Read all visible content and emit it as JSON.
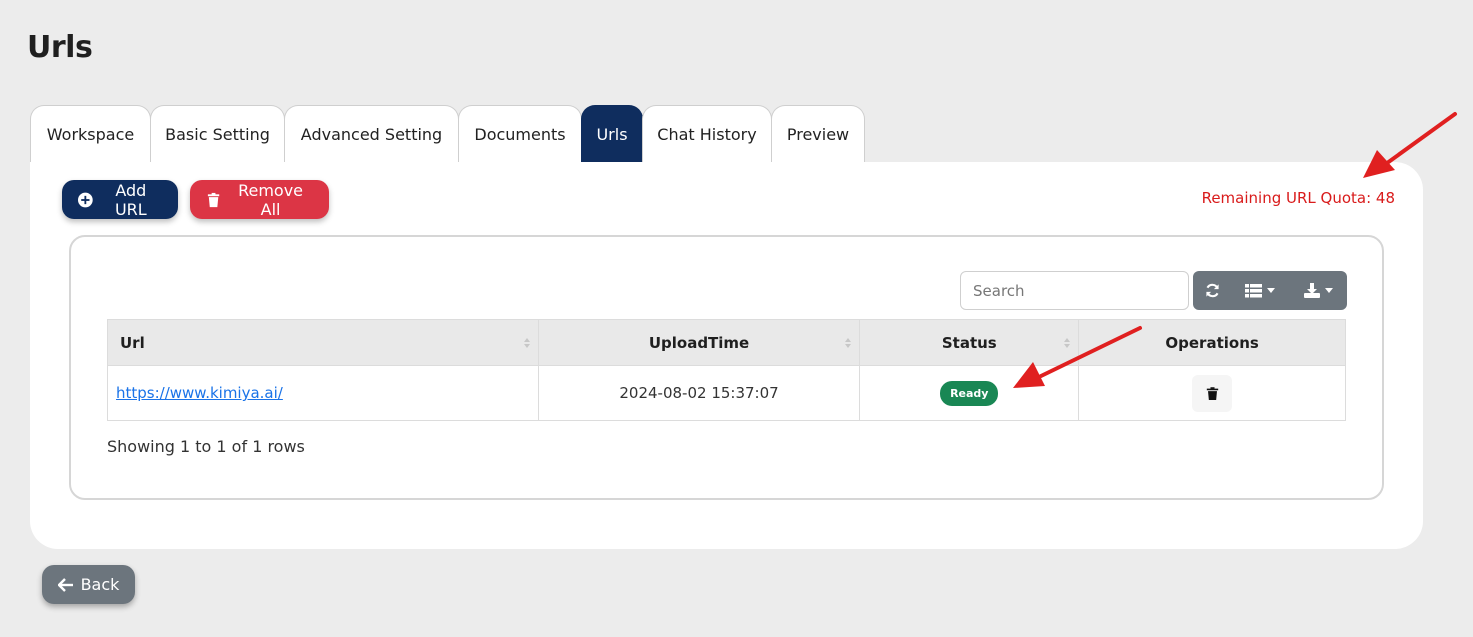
{
  "page": {
    "title": "Urls"
  },
  "tabs": [
    {
      "label": "Workspace",
      "active": false
    },
    {
      "label": "Basic Setting",
      "active": false
    },
    {
      "label": "Advanced Setting",
      "active": false
    },
    {
      "label": "Documents",
      "active": false
    },
    {
      "label": "Urls",
      "active": true
    },
    {
      "label": "Chat History",
      "active": false
    },
    {
      "label": "Preview",
      "active": false
    }
  ],
  "actions": {
    "add_url": "Add URL",
    "remove_all": "Remove All"
  },
  "quota": {
    "text": "Remaining URL Quota: 48"
  },
  "table": {
    "search_placeholder": "Search",
    "columns": [
      "Url",
      "UploadTime",
      "Status",
      "Operations"
    ],
    "rows": [
      {
        "url": "https://www.kimiya.ai/",
        "upload_time": "2024-08-02 15:37:07",
        "status": "Ready"
      }
    ],
    "footer": "Showing 1 to 1 of 1 rows"
  },
  "back": {
    "label": "Back"
  },
  "icons": {
    "add": "plus-circle-icon",
    "remove": "trash-icon",
    "refresh": "refresh-icon",
    "columns": "list-icon",
    "export": "download-icon",
    "delete": "trash-icon",
    "back": "arrow-left-icon"
  },
  "colors": {
    "primary": "#0f2d5e",
    "danger": "#dc3545",
    "secondary": "#6c757d",
    "success": "#198754",
    "quota": "#d91b1b",
    "annotation": "#e02020"
  }
}
